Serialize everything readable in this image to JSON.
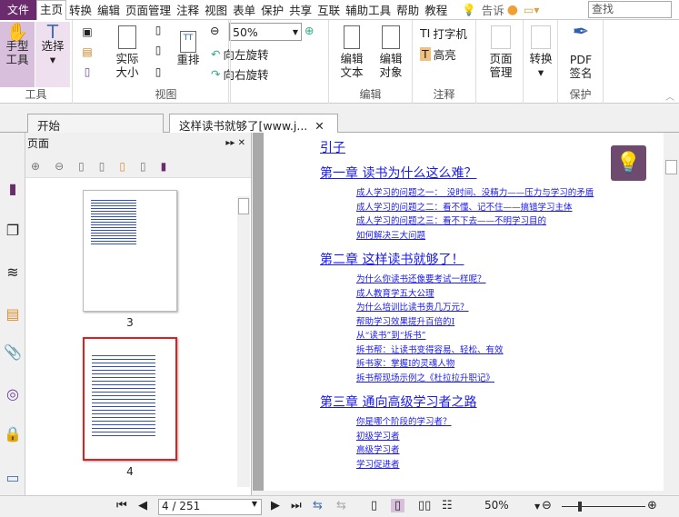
{
  "menu": {
    "file": "文件",
    "items": [
      "主页",
      "转换",
      "编辑",
      "页面管理",
      "注释",
      "视图",
      "表单",
      "保护",
      "共享",
      "互联",
      "辅助工具",
      "帮助",
      "教程"
    ],
    "tell": "告诉",
    "search_placeholder": "查找"
  },
  "ribbon": {
    "tools": {
      "hand": "手型\n工具",
      "select": "选择",
      "label": "工具"
    },
    "view": {
      "actual": "实际\n大小",
      "reflow": "重排",
      "zoom": "50%",
      "rotate_left": "向左旋转",
      "rotate_right": "向右旋转",
      "label": "视图"
    },
    "edit": {
      "edit_text": "编辑\n文本",
      "edit_obj": "编辑\n对象",
      "label": "编辑"
    },
    "comment": {
      "typewriter": "打字机",
      "highlight": "高亮",
      "label": "注释"
    },
    "page": {
      "manage": "页面\n管理"
    },
    "convert": {
      "convert": "转换"
    },
    "protect": {
      "sign": "PDF\n签名",
      "label": "保护"
    }
  },
  "tabs": [
    {
      "label": "开始"
    },
    {
      "label": "这样读书就够了[www.j..."
    }
  ],
  "pages_panel": {
    "title": "页面",
    "thumbs": [
      {
        "num": "3"
      },
      {
        "num": "4"
      }
    ]
  },
  "doc": {
    "intro": "引子",
    "chapters": [
      {
        "title": "第一章 读书为什么这么难？",
        "items": [
          "成人学习的问题之一：　没时间、没精力——压力与学习的矛盾",
          "成人学习的问题之二：看不懂、记不住——搞错学习主体",
          "成人学习的问题之三：看不下去——不明学习目的",
          "如何解决三大问题"
        ]
      },
      {
        "title": "第二章 这样读书就够了！",
        "items": [
          "为什么你读书还像要考试一样呢？",
          "成人教育学五大公理",
          "为什么培训比读书贵几万元？",
          "帮助学习效果提升百倍的I",
          "从“读书”到“拆书”",
          "拆书帮：让读书变得容易、轻松、有效",
          "拆书家：掌握I的灵魂人物",
          "拆书帮现场示例之《杜拉拉升职记》"
        ]
      },
      {
        "title": "第三章 通向高级学习者之路",
        "items": [
          "你是哪个阶段的学习者？",
          "初级学习者",
          "高级学习者",
          "学习促进者"
        ]
      }
    ]
  },
  "status": {
    "page": "4 / 251",
    "zoom": "50%"
  }
}
